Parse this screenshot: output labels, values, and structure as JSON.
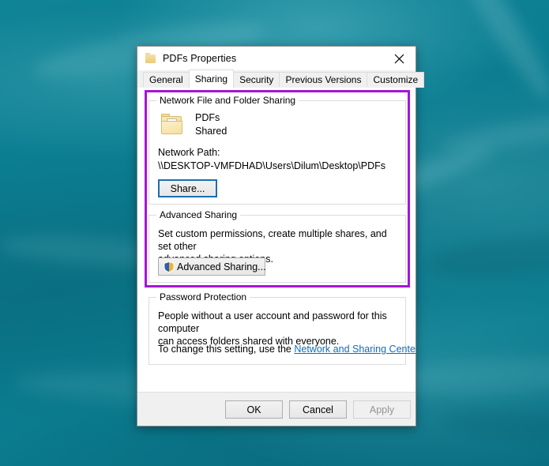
{
  "window": {
    "title": "PDFs Properties",
    "icon": "folder-icon",
    "close_label": "✕"
  },
  "tabs": [
    {
      "label": "General",
      "active": false
    },
    {
      "label": "Sharing",
      "active": true
    },
    {
      "label": "Security",
      "active": false
    },
    {
      "label": "Previous Versions",
      "active": false
    },
    {
      "label": "Customize",
      "active": false
    }
  ],
  "highlight": {
    "color": "#a714d8",
    "note": "purple annotation box around Network File and Folder Sharing + Advanced Sharing"
  },
  "network_group": {
    "title": "Network File and Folder Sharing",
    "folder_name": "PDFs",
    "share_state": "Shared",
    "path_label": "Network Path:",
    "path_value": "\\\\DESKTOP-VMFDHAD\\Users\\Dilum\\Desktop\\PDFs",
    "share_button": "Share...",
    "share_button_focus_color": "#1b6fae"
  },
  "advanced_group": {
    "title": "Advanced Sharing",
    "description_line1": "Set custom permissions, create multiple shares, and set other",
    "description_line2": "advanced sharing options.",
    "button_label": "Advanced Sharing...",
    "button_icon": "uac-shield-icon"
  },
  "password_group": {
    "title": "Password Protection",
    "description_line1": "People without a user account and password for this computer",
    "description_line2": "can access folders shared with everyone.",
    "change_prefix": "To change this setting, use the ",
    "link_text": "Network and Sharing Center",
    "change_suffix": ".",
    "link_color": "#0b6ec1"
  },
  "footer": {
    "ok": "OK",
    "cancel": "Cancel",
    "apply": "Apply",
    "apply_disabled": true
  },
  "desktop": {
    "wallpaper_color": "#0c7e92"
  }
}
